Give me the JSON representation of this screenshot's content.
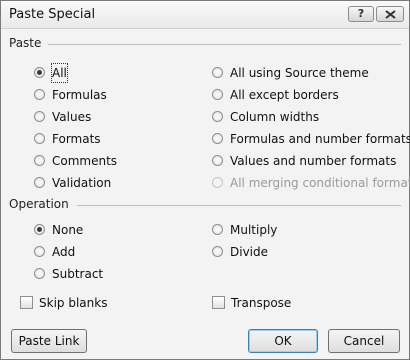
{
  "window": {
    "title": "Paste Special",
    "help_label": "?"
  },
  "paste": {
    "label": "Paste",
    "left": [
      {
        "label": "All",
        "checked": true
      },
      {
        "label": "Formulas",
        "checked": false
      },
      {
        "label": "Values",
        "checked": false
      },
      {
        "label": "Formats",
        "checked": false
      },
      {
        "label": "Comments",
        "checked": false
      },
      {
        "label": "Validation",
        "checked": false
      }
    ],
    "right": [
      {
        "label": "All using Source theme",
        "checked": false
      },
      {
        "label": "All except borders",
        "checked": false
      },
      {
        "label": "Column widths",
        "checked": false
      },
      {
        "label": "Formulas and number formats",
        "checked": false
      },
      {
        "label": "Values and number formats",
        "checked": false
      },
      {
        "label": "All merging conditional formats",
        "checked": false,
        "disabled": true
      }
    ]
  },
  "operation": {
    "label": "Operation",
    "left": [
      {
        "label": "None",
        "checked": true
      },
      {
        "label": "Add",
        "checked": false
      },
      {
        "label": "Subtract",
        "checked": false
      }
    ],
    "right": [
      {
        "label": "Multiply",
        "checked": false
      },
      {
        "label": "Divide",
        "checked": false
      }
    ]
  },
  "options": {
    "skip_blanks": {
      "label": "Skip blanks",
      "checked": false
    },
    "transpose": {
      "label": "Transpose",
      "checked": false
    }
  },
  "buttons": {
    "paste_link": "Paste Link",
    "ok": "OK",
    "cancel": "Cancel"
  }
}
